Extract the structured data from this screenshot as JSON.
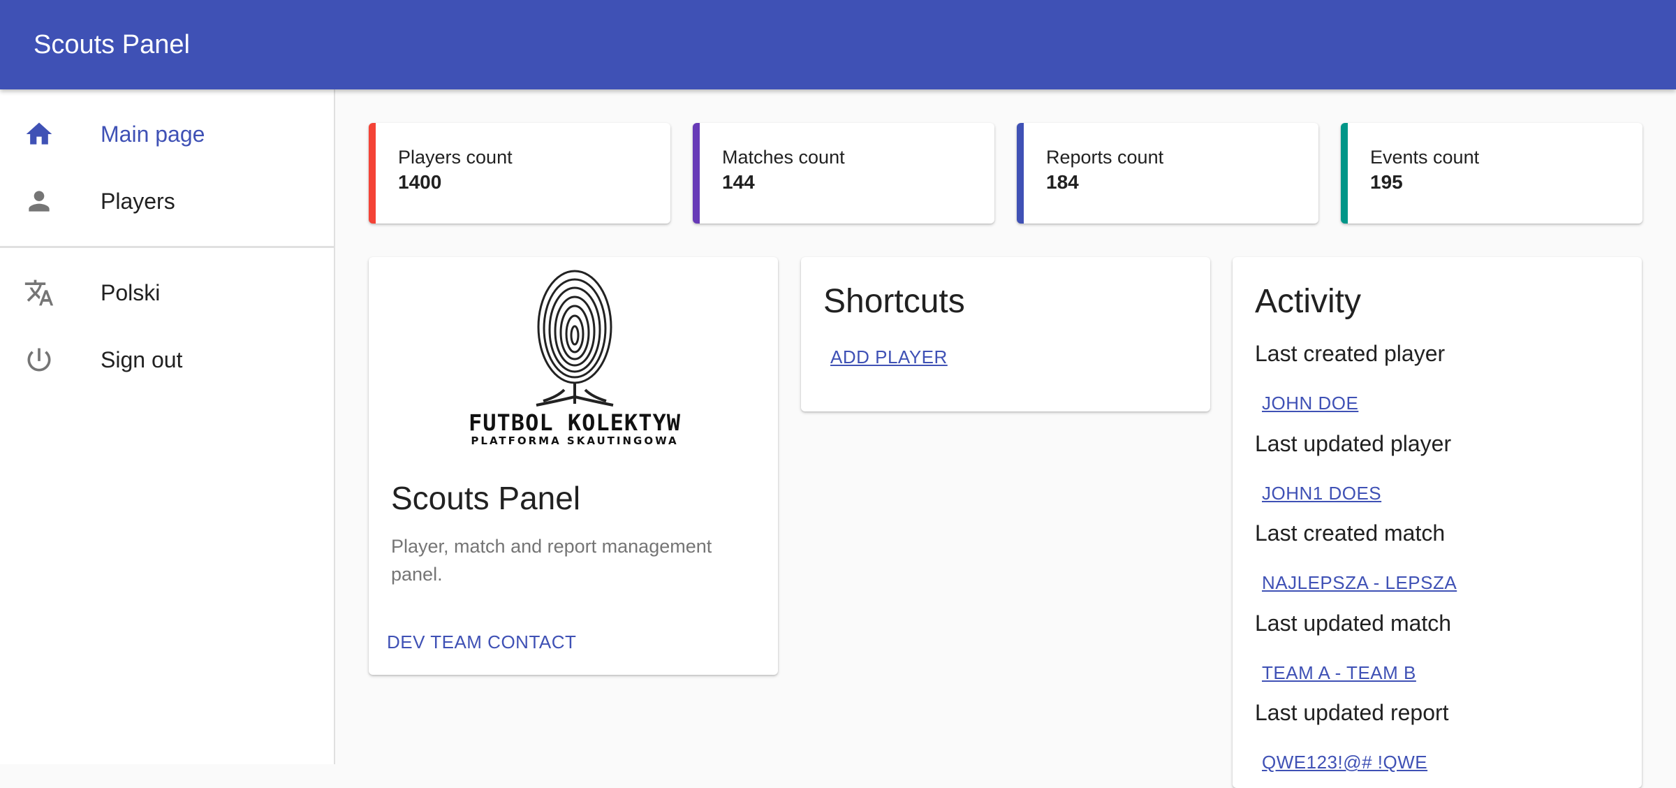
{
  "appbar": {
    "title": "Scouts Panel"
  },
  "sidebar": {
    "items": [
      {
        "label": "Main page",
        "icon": "home-icon",
        "active": true
      },
      {
        "label": "Players",
        "icon": "person-icon",
        "active": false
      },
      {
        "label": "Polski",
        "icon": "translate-icon",
        "active": false
      },
      {
        "label": "Sign out",
        "icon": "power-icon",
        "active": false
      }
    ]
  },
  "stats": [
    {
      "label": "Players count",
      "value": "1400",
      "color": "#f44336"
    },
    {
      "label": "Matches count",
      "value": "144",
      "color": "#673ab7"
    },
    {
      "label": "Reports count",
      "value": "184",
      "color": "#3f51b5"
    },
    {
      "label": "Events count",
      "value": "195",
      "color": "#009688"
    }
  ],
  "about_card": {
    "logo_line1": "FUTBOL KOLEKTYW",
    "logo_line2": "PLATFORMA SKAUTINGOWA",
    "title": "Scouts Panel",
    "description": "Player, match and report management panel.",
    "contact_button": "DEV TEAM CONTACT"
  },
  "shortcuts_card": {
    "title": "Shortcuts",
    "add_player": "ADD PLAYER"
  },
  "activity_card": {
    "title": "Activity",
    "items": [
      {
        "label": "Last created player",
        "link": "JOHN DOE"
      },
      {
        "label": "Last updated player",
        "link": "JOHN1 DOES"
      },
      {
        "label": "Last created match",
        "link": "NAJLEPSZA - LEPSZA"
      },
      {
        "label": "Last updated match",
        "link": "TEAM A - TEAM B"
      },
      {
        "label": "Last updated report",
        "link": "QWE123!@# !QWE"
      }
    ]
  },
  "colors": {
    "primary": "#3f51b5",
    "background": "#fafafa"
  }
}
